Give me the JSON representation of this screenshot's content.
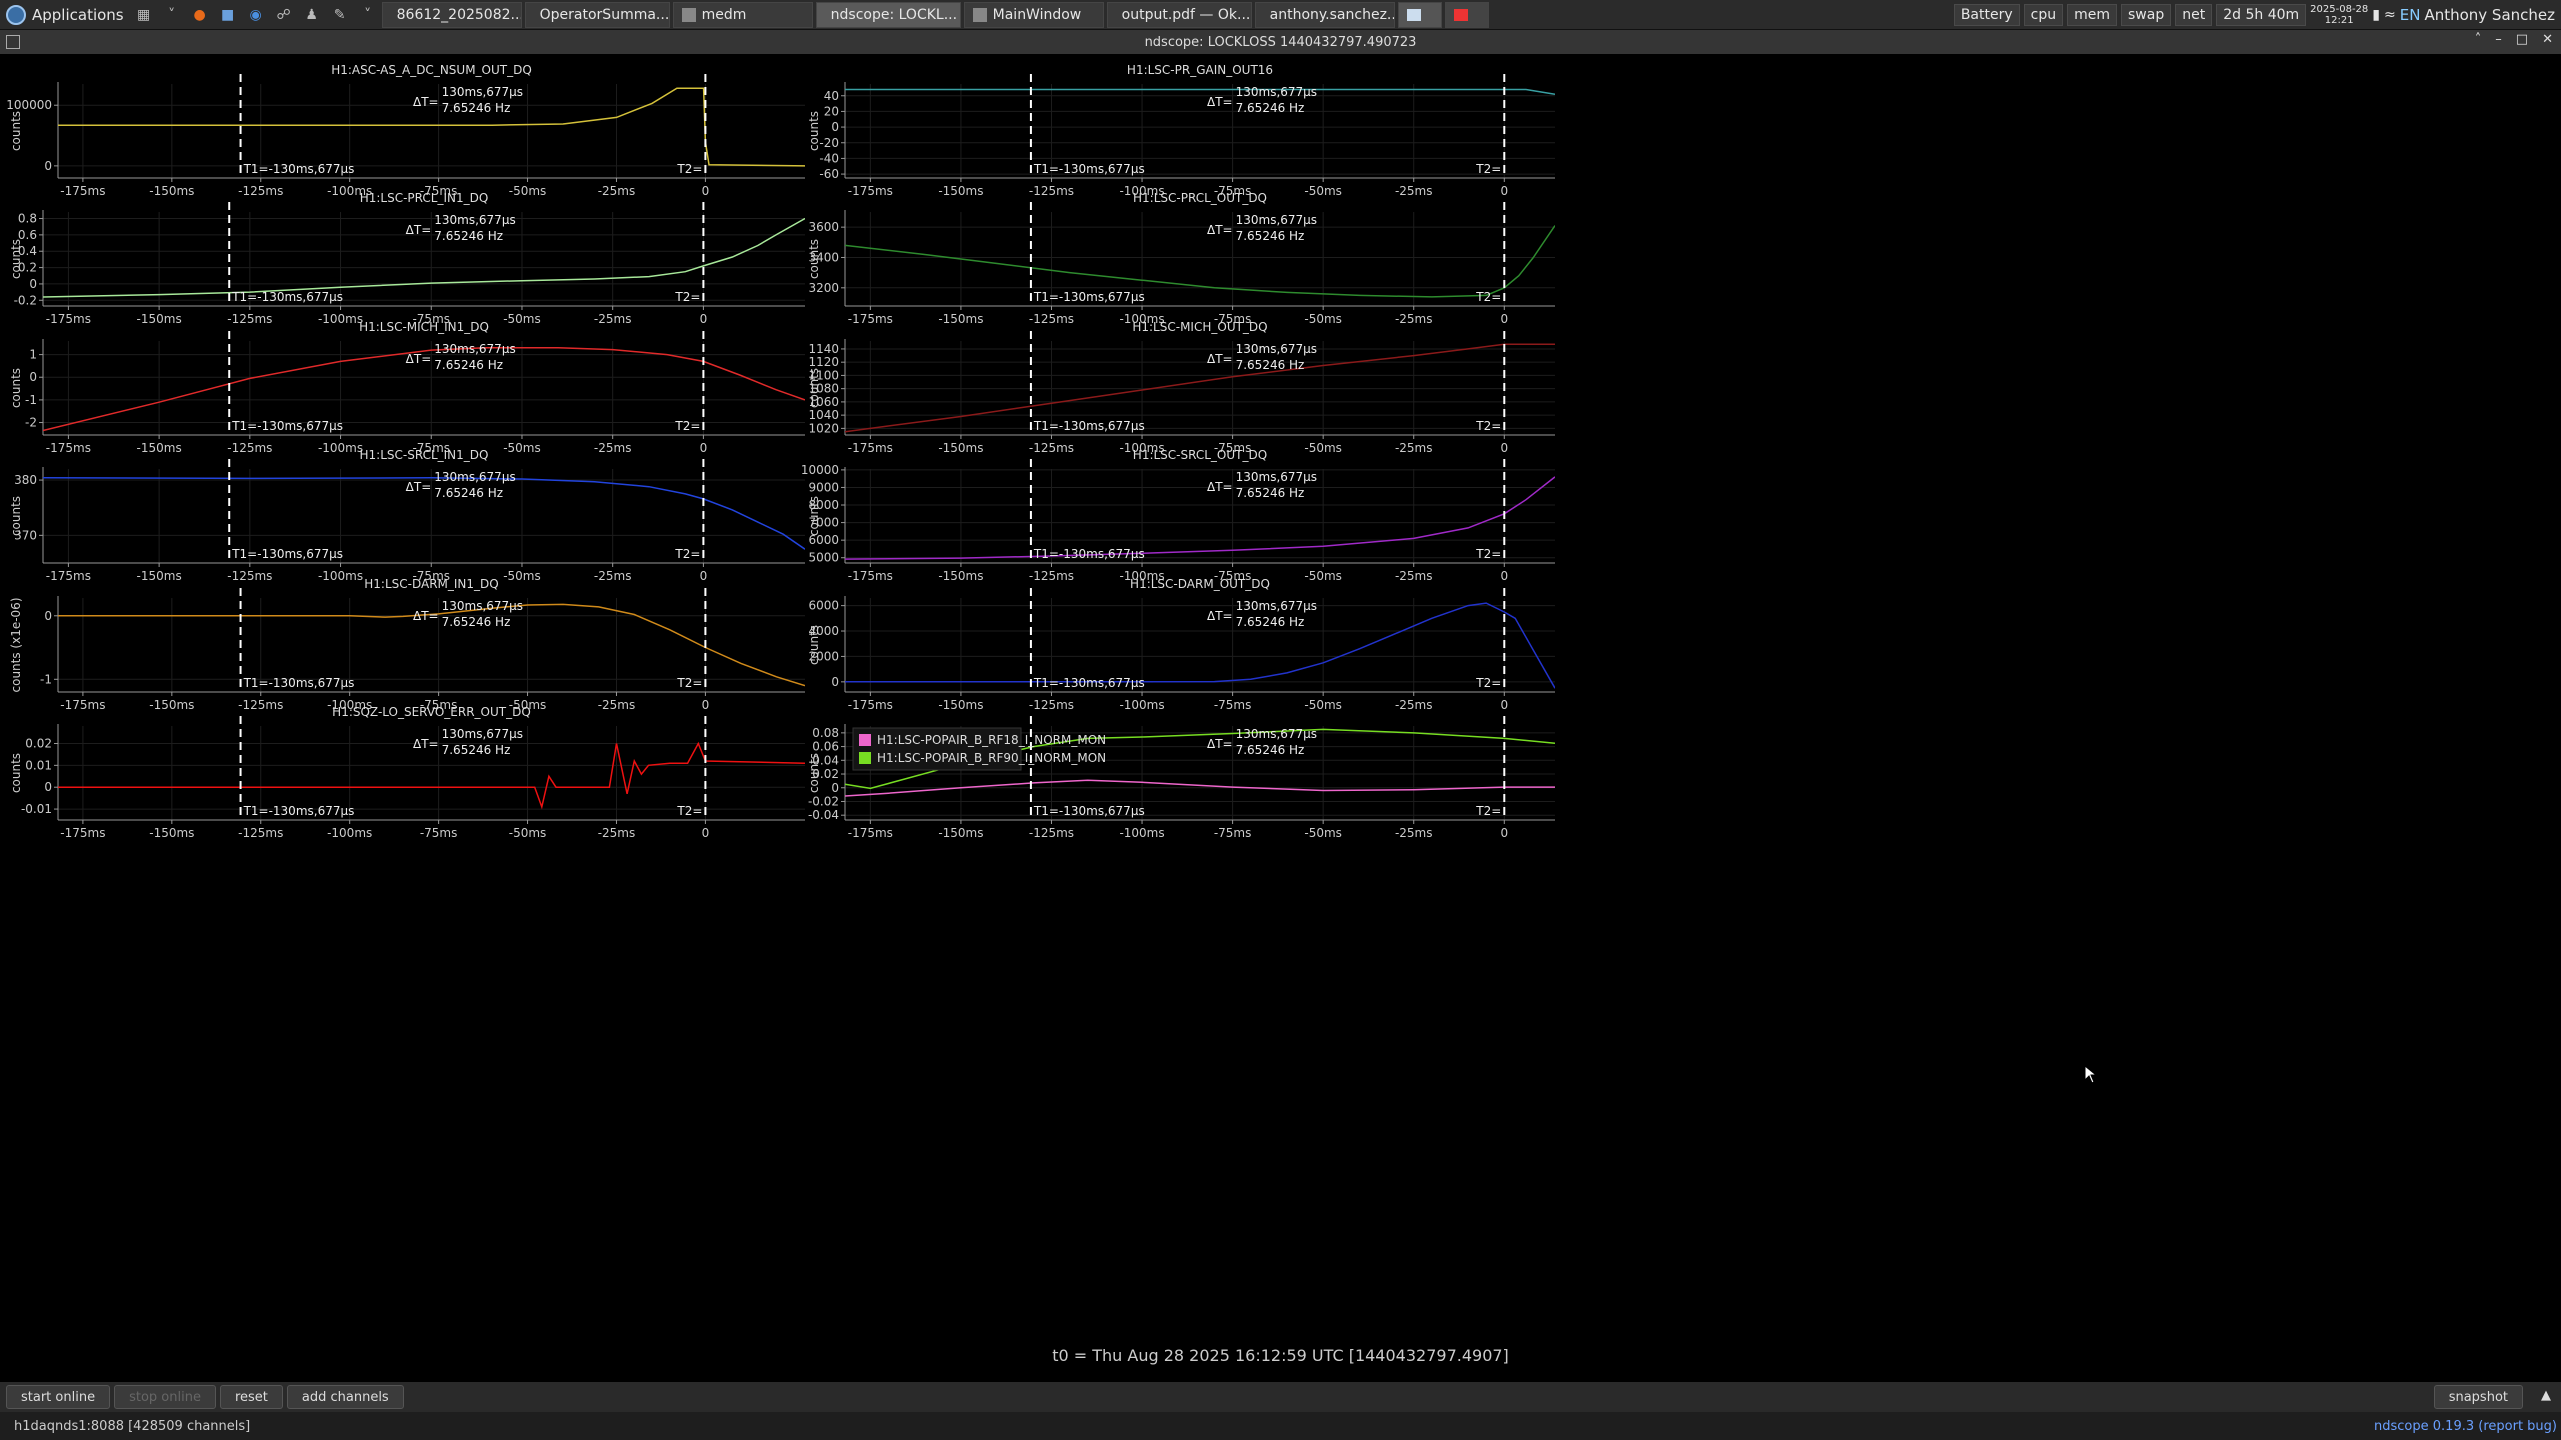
{
  "taskbar": {
    "apps_label": "Applications",
    "tasks": [
      {
        "label": "86612_2025082...",
        "icon": "firefox-icon"
      },
      {
        "label": "OperatorSumma...",
        "icon": "document-icon"
      },
      {
        "label": "medm",
        "icon": "window-icon"
      },
      {
        "label": "ndscope: LOCKL...",
        "icon": "window-icon"
      },
      {
        "label": "MainWindow",
        "icon": "window-icon"
      },
      {
        "label": "output.pdf — Ok...",
        "icon": "pdf-icon"
      },
      {
        "label": "anthony.sanchez...",
        "icon": "terminal-icon"
      }
    ],
    "tray": [
      "Battery",
      "cpu",
      "mem",
      "swap",
      "net",
      "2d 5h 40m"
    ],
    "clock_date": "2025-08-28",
    "clock_time": "12:21",
    "lang": "EN",
    "user": "Anthony Sanchez"
  },
  "window": {
    "title": "ndscope: LOCKLOSS 1440432797.490723"
  },
  "cursors": {
    "t1_label": "T1=-130ms,677µs",
    "t2_label": "T2=",
    "dt_label": "ΔT=",
    "dt_value": "130ms,677µs",
    "freq_value": "7.65246 Hz"
  },
  "x_ticks": [
    "-175ms",
    "-150ms",
    "-125ms",
    "-100ms",
    "-75ms",
    "-50ms",
    "-25ms",
    "0"
  ],
  "x_tick_values": [
    -175,
    -150,
    -125,
    -100,
    -75,
    -50,
    -25,
    0
  ],
  "chart_data": [
    {
      "type": "line",
      "title": "H1:ASC-AS_A_DC_NSUM_OUT_DQ",
      "ylabel": "counts",
      "yticks": [
        "100000",
        "0"
      ],
      "ytick_values": [
        100000,
        0
      ],
      "ylim": [
        -20000,
        135000
      ],
      "xlim": [
        -182,
        28
      ],
      "series": [
        {
          "color": "#d4c13a",
          "x": [
            -182,
            -60,
            -40,
            -25,
            -15,
            -8,
            -2,
            -0.5,
            0,
            1,
            28
          ],
          "y": [
            67000,
            67000,
            69000,
            80000,
            103000,
            128000,
            128000,
            128000,
            40000,
            2000,
            0
          ]
        }
      ]
    },
    {
      "type": "line",
      "title": "H1:LSC-PR_GAIN_OUT16",
      "ylabel": "counts",
      "yticks": [
        "40",
        "20",
        "0",
        "-20",
        "-40",
        "-60"
      ],
      "ytick_values": [
        40,
        20,
        0,
        -20,
        -40,
        -60
      ],
      "ylim": [
        -65,
        55
      ],
      "xlim": [
        -182,
        14
      ],
      "series": [
        {
          "color": "#39a0a3",
          "x": [
            -182,
            0,
            6,
            14
          ],
          "y": [
            48,
            48,
            48,
            42
          ]
        }
      ]
    },
    {
      "type": "line",
      "title": "H1:LSC-PRCL_IN1_DQ",
      "ylabel": "counts",
      "yticks": [
        "0.8",
        "0.6",
        "0.4",
        "0.2",
        "0",
        "-0.2"
      ],
      "ytick_values": [
        0.8,
        0.6,
        0.4,
        0.2,
        0,
        -0.2
      ],
      "ylim": [
        -0.27,
        0.88
      ],
      "xlim": [
        -182,
        28
      ],
      "series": [
        {
          "color": "#a8e89a",
          "x": [
            -182,
            -150,
            -125,
            -100,
            -75,
            -50,
            -30,
            -15,
            -5,
            0,
            8,
            15,
            20,
            28
          ],
          "y": [
            -0.16,
            -0.13,
            -0.1,
            -0.04,
            0.01,
            0.04,
            0.06,
            0.09,
            0.15,
            0.22,
            0.33,
            0.47,
            0.6,
            0.8
          ]
        }
      ]
    },
    {
      "type": "line",
      "title": "H1:LSC-PRCL_OUT_DQ",
      "ylabel": "counts",
      "yticks": [
        "3600",
        "3400",
        "3200"
      ],
      "ytick_values": [
        3600,
        3400,
        3200
      ],
      "ylim": [
        3080,
        3700
      ],
      "xlim": [
        -182,
        14
      ],
      "series": [
        {
          "color": "#2e8b2e",
          "x": [
            -182,
            -160,
            -140,
            -120,
            -100,
            -80,
            -60,
            -40,
            -20,
            -5,
            0,
            4,
            8,
            14
          ],
          "y": [
            3480,
            3420,
            3360,
            3300,
            3250,
            3200,
            3170,
            3150,
            3140,
            3150,
            3200,
            3280,
            3400,
            3610
          ]
        }
      ]
    },
    {
      "type": "line",
      "title": "H1:LSC-MICH_IN1_DQ",
      "ylabel": "counts",
      "yticks": [
        "1",
        "0",
        "-1",
        "-2"
      ],
      "ytick_values": [
        1,
        0,
        -1,
        -2
      ],
      "ylim": [
        -2.55,
        1.6
      ],
      "xlim": [
        -182,
        28
      ],
      "series": [
        {
          "color": "#e02a2a",
          "x": [
            -182,
            -150,
            -125,
            -100,
            -75,
            -60,
            -40,
            -25,
            -10,
            0,
            10,
            20,
            28
          ],
          "y": [
            -2.35,
            -1.1,
            -0.05,
            0.7,
            1.2,
            1.3,
            1.3,
            1.22,
            1.0,
            0.7,
            0.1,
            -0.55,
            -1.0
          ]
        }
      ]
    },
    {
      "type": "line",
      "title": "H1:LSC-MICH_OUT_DQ",
      "ylabel": "counts",
      "yticks": [
        "1140",
        "1120",
        "1100",
        "1080",
        "1060",
        "1040",
        "1020"
      ],
      "ytick_values": [
        1140,
        1120,
        1100,
        1080,
        1060,
        1040,
        1020
      ],
      "ylim": [
        1010,
        1152
      ],
      "xlim": [
        -182,
        14
      ],
      "series": [
        {
          "color": "#8b1a1a",
          "x": [
            -182,
            -150,
            -125,
            -100,
            -75,
            -50,
            -25,
            -10,
            0,
            14
          ],
          "y": [
            1015,
            1038,
            1058,
            1078,
            1098,
            1115,
            1130,
            1140,
            1147,
            1147
          ]
        }
      ]
    },
    {
      "type": "line",
      "title": "H1:LSC-SRCL_IN1_DQ",
      "ylabel": "counts",
      "yticks": [
        "380",
        "370"
      ],
      "ytick_values": [
        380,
        370
      ],
      "ylim": [
        365,
        382
      ],
      "xlim": [
        -182,
        28
      ],
      "series": [
        {
          "color": "#2244dd",
          "x": [
            -182,
            -125,
            -75,
            -50,
            -30,
            -15,
            -5,
            0,
            8,
            15,
            22,
            28
          ],
          "y": [
            380.4,
            380.3,
            380.4,
            380.2,
            379.7,
            378.8,
            377.5,
            376.6,
            374.6,
            372.4,
            370.2,
            367.5
          ]
        }
      ]
    },
    {
      "type": "line",
      "title": "H1:LSC-SRCL_OUT_DQ",
      "ylabel": "counts",
      "yticks": [
        "10000",
        "9000",
        "8000",
        "7000",
        "6000",
        "5000"
      ],
      "ytick_values": [
        10000,
        9000,
        8000,
        7000,
        6000,
        5000
      ],
      "ylim": [
        4700,
        10050
      ],
      "xlim": [
        -182,
        14
      ],
      "series": [
        {
          "color": "#a02ac8",
          "x": [
            -182,
            -150,
            -125,
            -100,
            -75,
            -50,
            -25,
            -10,
            0,
            6,
            14
          ],
          "y": [
            4920,
            4980,
            5100,
            5250,
            5420,
            5650,
            6100,
            6700,
            7500,
            8300,
            9600
          ]
        }
      ]
    },
    {
      "type": "line",
      "title": "H1:LSC-DARM_IN1_DQ",
      "ylabel": "counts (x1e-06)",
      "yticks": [
        "0",
        "-1"
      ],
      "ytick_values": [
        0,
        -1
      ],
      "ylim": [
        -1.2,
        0.28
      ],
      "xlim": [
        -182,
        28
      ],
      "series": [
        {
          "color": "#d08a1a",
          "x": [
            -182,
            -100,
            -90,
            -85,
            -75,
            -60,
            -50,
            -40,
            -30,
            -20,
            -10,
            0,
            10,
            20,
            28
          ],
          "y": [
            0,
            0,
            -0.02,
            -0.01,
            0.03,
            0.12,
            0.17,
            0.18,
            0.14,
            0.02,
            -0.22,
            -0.5,
            -0.75,
            -0.96,
            -1.1
          ]
        }
      ]
    },
    {
      "type": "line",
      "title": "H1:LSC-DARM_OUT_DQ",
      "ylabel": "counts",
      "yticks": [
        "6000",
        "4000",
        "2000",
        "0"
      ],
      "ytick_values": [
        6000,
        4000,
        2000,
        0
      ],
      "ylim": [
        -800,
        6600
      ],
      "xlim": [
        -182,
        14
      ],
      "series": [
        {
          "color": "#2233cc",
          "x": [
            -182,
            -100,
            -80,
            -70,
            -60,
            -50,
            -40,
            -30,
            -20,
            -10,
            -5,
            0,
            3,
            8,
            14
          ],
          "y": [
            0,
            0,
            20,
            200,
            700,
            1500,
            2600,
            3800,
            5000,
            6000,
            6200,
            5500,
            5000,
            2500,
            -500
          ]
        }
      ]
    },
    {
      "type": "line",
      "title": "H1:SQZ-LO_SERVO_ERR_OUT_DQ",
      "ylabel": "counts",
      "yticks": [
        "0.02",
        "0.01",
        "0",
        "-0.01"
      ],
      "ytick_values": [
        0.02,
        0.01,
        0,
        -0.01
      ],
      "ylim": [
        -0.015,
        0.028
      ],
      "xlim": [
        -182,
        28
      ],
      "series": [
        {
          "color": "#ee1111",
          "x": [
            -182,
            -48,
            -46,
            -44,
            -42,
            -27,
            -25,
            -22,
            -20,
            -18,
            -16,
            -10,
            -5,
            -2,
            0,
            28
          ],
          "y": [
            0,
            0,
            -0.009,
            0.005,
            0,
            0,
            0.02,
            -0.003,
            0.012,
            0.006,
            0.01,
            0.011,
            0.011,
            0.02,
            0.012,
            0.011
          ]
        }
      ]
    },
    {
      "type": "line",
      "title": "",
      "ylabel": "counts",
      "yticks": [
        "0.08",
        "0.06",
        "0.04",
        "0.02",
        "0",
        "-0.02",
        "-0.04"
      ],
      "ytick_values": [
        0.08,
        0.06,
        0.04,
        0.02,
        0,
        -0.02,
        -0.04
      ],
      "ylim": [
        -0.047,
        0.09
      ],
      "xlim": [
        -182,
        14
      ],
      "legend": "top-left",
      "series": [
        {
          "name": "H1:LSC-POPAIR_B_RF18_I_NORM_MON",
          "color": "#ee66cc",
          "x": [
            -182,
            -170,
            -150,
            -130,
            -115,
            -100,
            -75,
            -50,
            -25,
            0,
            14
          ],
          "y": [
            -0.012,
            -0.008,
            0,
            0.007,
            0.011,
            0.008,
            0.001,
            -0.004,
            -0.003,
            0.001,
            0.001
          ]
        },
        {
          "name": "H1:LSC-POPAIR_B_RF90_I_NORM_MON",
          "color": "#77dd22",
          "x": [
            -182,
            -175,
            -150,
            -130,
            -115,
            -100,
            -75,
            -50,
            -25,
            0,
            14
          ],
          "y": [
            0.005,
            -0.001,
            0.035,
            0.06,
            0.072,
            0.074,
            0.079,
            0.085,
            0.08,
            0.072,
            0.065
          ]
        }
      ]
    }
  ],
  "t0_label": "t0 = Thu Aug 28 2025 16:12:59 UTC [1440432797.4907]",
  "controls": {
    "start_online": "start online",
    "stop_online": "stop online",
    "reset": "reset",
    "add_channels": "add channels",
    "snapshot": "snapshot"
  },
  "status": {
    "server": "h1daqnds1:8088  [428509 channels]",
    "version_link": "ndscope 0.19.3",
    "report_bug": "(report bug)"
  }
}
